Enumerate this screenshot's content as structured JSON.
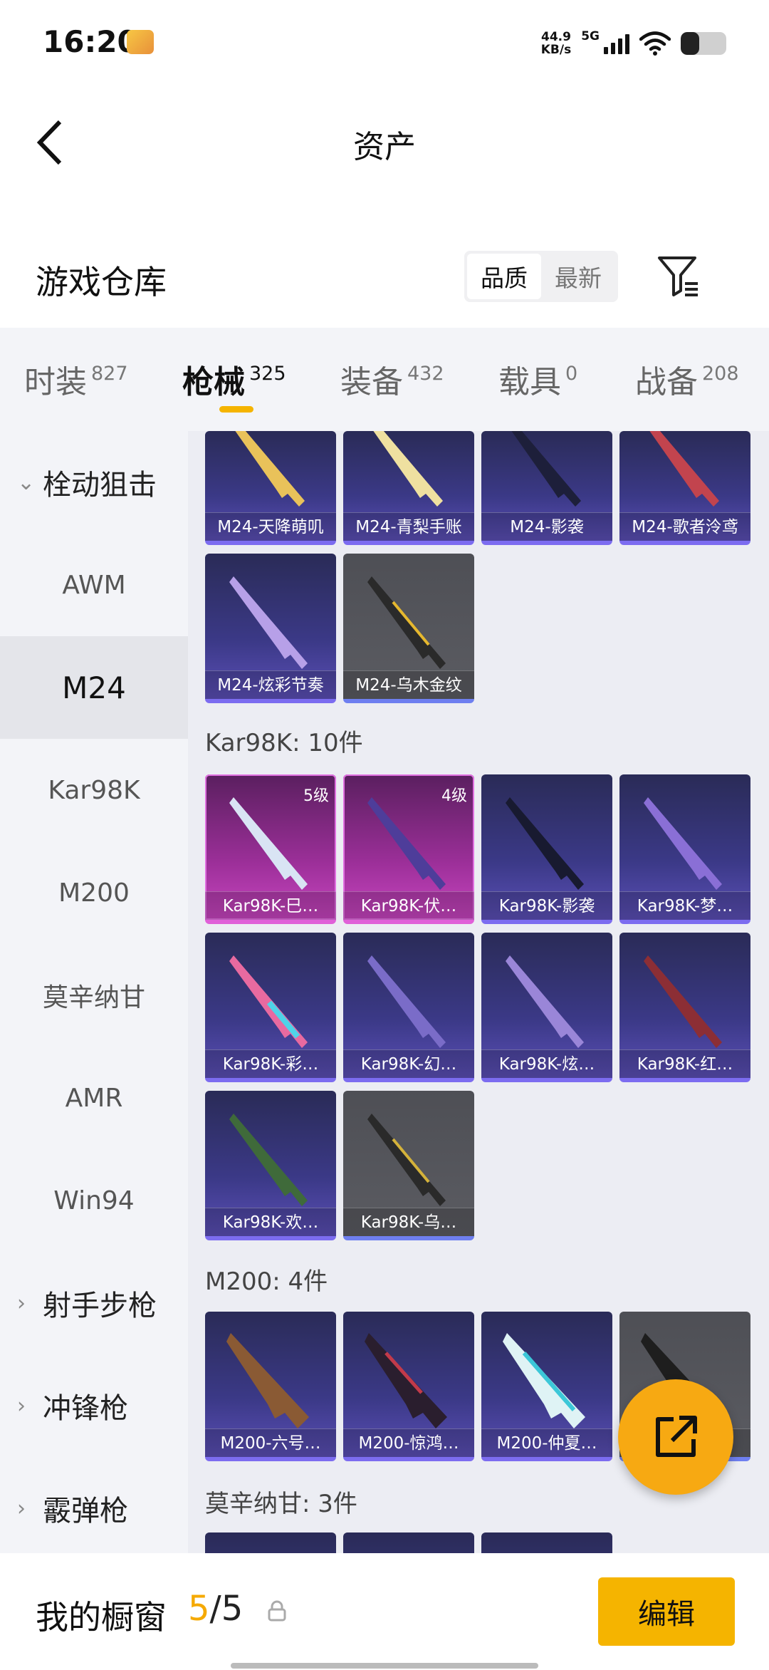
{
  "status": {
    "time": "16:20",
    "net_speed_value": "44.9",
    "net_speed_unit": "KB/s",
    "network": "5G",
    "battery_level": 0.4
  },
  "header": {
    "title": "资产"
  },
  "warehouse": {
    "title": "游戏仓库",
    "sort_options": [
      "品质",
      "最新"
    ],
    "active_sort": "品质"
  },
  "tabs": [
    {
      "label": "时装",
      "count": "827"
    },
    {
      "label": "枪械",
      "count": "325"
    },
    {
      "label": "装备",
      "count": "432"
    },
    {
      "label": "载具",
      "count": "0"
    },
    {
      "label": "战备",
      "count": "208"
    }
  ],
  "sidebar": {
    "items": [
      {
        "label": "栓动狙击",
        "type": "group",
        "chevron": "chevron-down-icon"
      },
      {
        "label": "AWM",
        "type": "item"
      },
      {
        "label": "M24",
        "type": "item",
        "selected": true
      },
      {
        "label": "Kar98K",
        "type": "item"
      },
      {
        "label": "M200",
        "type": "item"
      },
      {
        "label": "莫辛纳甘",
        "type": "item"
      },
      {
        "label": "AMR",
        "type": "item"
      },
      {
        "label": "Win94",
        "type": "item"
      },
      {
        "label": "射手步枪",
        "type": "group",
        "chevron": "chevron-right-icon"
      },
      {
        "label": "冲锋枪",
        "type": "group",
        "chevron": "chevron-right-icon"
      },
      {
        "label": "霰弹枪",
        "type": "group",
        "chevron": "chevron-right-icon"
      }
    ]
  },
  "sections": {
    "m24": {
      "items": [
        {
          "name": "M24-天降萌叽"
        },
        {
          "name": "M24-青梨手账"
        },
        {
          "name": "M24-影袭"
        },
        {
          "name": "M24-歌者泠鸢"
        },
        {
          "name": "M24-炫彩节奏"
        },
        {
          "name": "M24-乌木金纹"
        }
      ]
    },
    "kar98k": {
      "title": "Kar98K: 10件",
      "items": [
        {
          "name": "Kar98K-巳…",
          "level": "5级"
        },
        {
          "name": "Kar98K-伏…",
          "level": "4级"
        },
        {
          "name": "Kar98K-影袭"
        },
        {
          "name": "Kar98K-梦…"
        },
        {
          "name": "Kar98K-彩…"
        },
        {
          "name": "Kar98K-幻…"
        },
        {
          "name": "Kar98K-炫…"
        },
        {
          "name": "Kar98K-红…"
        },
        {
          "name": "Kar98K-欢…"
        },
        {
          "name": "Kar98K-乌…"
        }
      ]
    },
    "m200": {
      "title": "M200: 4件",
      "items": [
        {
          "name": "M200-六号…"
        },
        {
          "name": "M200-惊鸿…"
        },
        {
          "name": "M200-仲夏…"
        },
        {
          "name": "…"
        }
      ]
    },
    "mosin": {
      "title": "莫辛纳甘: 3件"
    }
  },
  "bottom": {
    "showcase_label": "我的橱窗",
    "showcase_current": "5",
    "showcase_total": "/5",
    "edit_label": "编辑"
  },
  "colors": {
    "accent": "#f5b400",
    "card_purple": "#3b3987",
    "card_pink": "#9b2f98",
    "card_gray": "#55565c"
  }
}
